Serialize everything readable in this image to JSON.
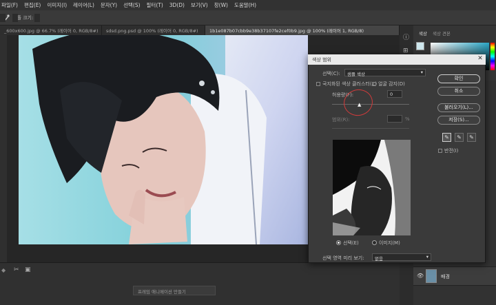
{
  "menubar": {
    "items": [
      "파일(F)",
      "편집(E)",
      "이미지(I)",
      "레이어(L)",
      "문자(Y)",
      "선택(S)",
      "필터(T)",
      "3D(D)",
      "보기(V)",
      "창(W)",
      "도움말(H)"
    ]
  },
  "options": {
    "sample_label": "샘플 크기:",
    "sample_value": "1 x 1 포인트",
    "display_label": "조합:",
    "display_value": "모든 레이어"
  },
  "tabs": [
    {
      "label": "_600x600.jpg @ 66.7% (레이어 0, RGB/8#)"
    },
    {
      "label": "sdsd.png.psd @ 100% (레이어 0, RGB/8#)"
    },
    {
      "label": "1b1e087b07cbb9e38b37107fe2cef0b9.jpg @ 100% (레이어 1, RGB/8)",
      "active": true
    }
  ],
  "bottom": {
    "timeline_button": "프레임 애니메이션 만들기"
  },
  "panels": {
    "color_tab": "색상",
    "swatches_tab": "색상 견본"
  },
  "layers": {
    "layer_name": "배경"
  },
  "dialog": {
    "title": "색상 범위",
    "select_label": "선택(C):",
    "select_value": "샘플 색상",
    "localized_label": "국지화된 색상 클러스터(Z)",
    "detect_faces_label": "얼굴 감지(D)",
    "fuzziness_label": "허용량(F):",
    "fuzziness_value": "0",
    "range_label": "범위(R):",
    "range_value": "",
    "range_unit": "%",
    "ok_button": "확인",
    "cancel_button": "취소",
    "load_button": "불러오기(L)...",
    "save_button": "저장(S)...",
    "invert_label": "반전(I)",
    "radio_selection": "선택(E)",
    "radio_image": "이미지(M)",
    "preview_label": "선택 영역 미리 보기:",
    "preview_value": "없음"
  },
  "colors": {
    "accent_annotation": "#d23b3b",
    "dialog_bg": "#3a3a3a"
  }
}
